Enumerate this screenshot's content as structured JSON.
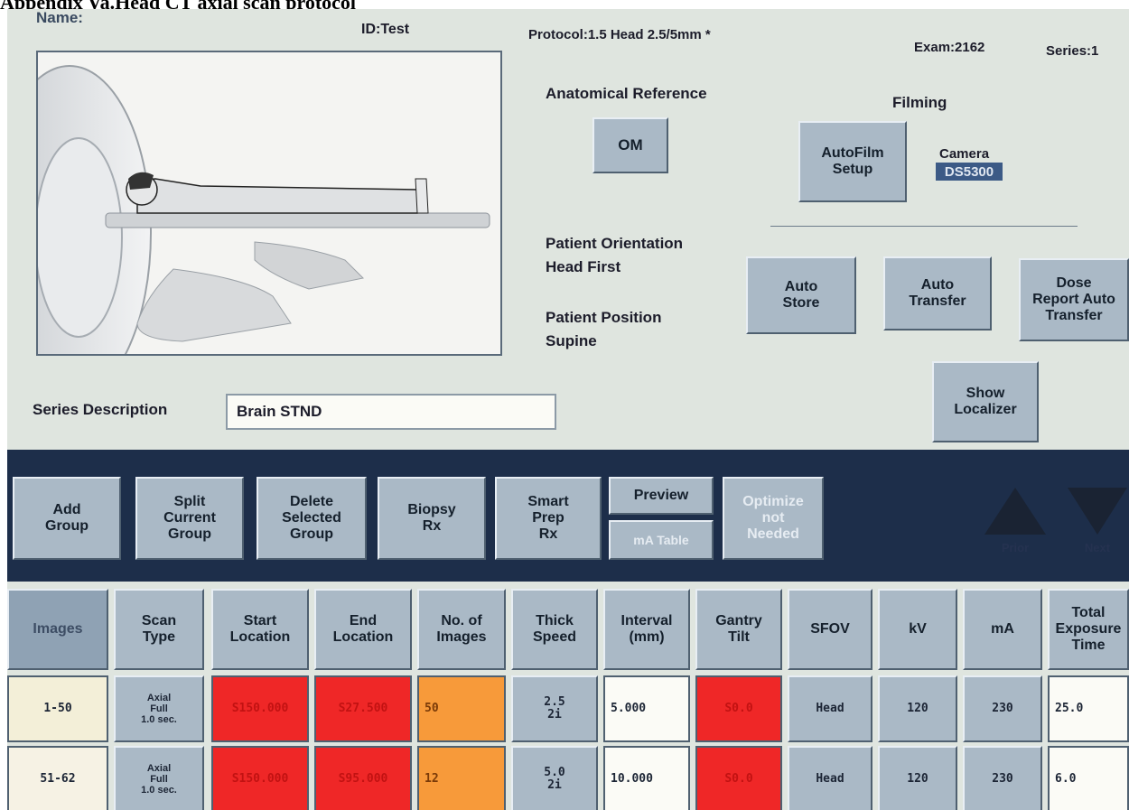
{
  "doc_title": "Appendix Va.Head CT axial scan protocol",
  "header": {
    "name_label": "Name:",
    "id_label": "ID:Test",
    "protocol": "Protocol:1.5 Head 2.5/5mm *",
    "exam": "Exam:2162",
    "series": "Series:1"
  },
  "anatomical_reference": {
    "label": "Anatomical Reference",
    "button": "OM"
  },
  "filming": {
    "label": "Filming",
    "autofilm_button": "AutoFilm\nSetup",
    "camera_label": "Camera",
    "camera_value": "DS5300"
  },
  "patient_orientation": {
    "label": "Patient Orientation",
    "value": "Head First"
  },
  "patient_position": {
    "label": "Patient Position",
    "value": "Supine"
  },
  "side_buttons": {
    "auto_store": "Auto\nStore",
    "auto_transfer": "Auto\nTransfer",
    "dose_report": "Dose\nReport Auto\nTransfer",
    "show_localizer": "Show\nLocalizer"
  },
  "series_description": {
    "label": "Series Description",
    "value": "Brain STND"
  },
  "toolbar": {
    "add_group": "Add\nGroup",
    "split_group": "Split\nCurrent\nGroup",
    "delete_group": "Delete\nSelected\nGroup",
    "biopsy": "Biopsy\nRx",
    "smart_prep": "Smart\nPrep\nRx",
    "preview": "Preview",
    "ma_table": "mA Table",
    "optimize": "Optimize\nnot\nNeeded",
    "prior": "Prior",
    "next": "Next"
  },
  "table": {
    "headers": [
      "Images",
      "Scan\nType",
      "Start\nLocation",
      "End\nLocation",
      "No. of\nImages",
      "Thick\nSpeed",
      "Interval\n(mm)",
      "Gantry\nTilt",
      "SFOV",
      "kV",
      "mA",
      "Total\nExposure\nTime"
    ],
    "rows": [
      [
        "1-50",
        "Axial\nFull\n1.0 sec.",
        "S150.000",
        "S27.500",
        "50",
        "2.5\n2i",
        "5.000",
        "S0.0",
        "Head",
        "120",
        "230",
        "25.0"
      ],
      [
        "51-62",
        "Axial\nFull\n1.0 sec.",
        "S150.000",
        "S95.000",
        "12",
        "5.0\n2i",
        "10.000",
        "S0.0",
        "Head",
        "120",
        "230",
        "6.0"
      ]
    ]
  },
  "colors": {
    "panel": "#dfe5df",
    "button": "#aab9c6",
    "toolbar_bar": "#1d2e4a",
    "red_cell": "#ef2727",
    "orange_cell": "#f79a3a",
    "camera_highlight": "#3c5a86"
  }
}
